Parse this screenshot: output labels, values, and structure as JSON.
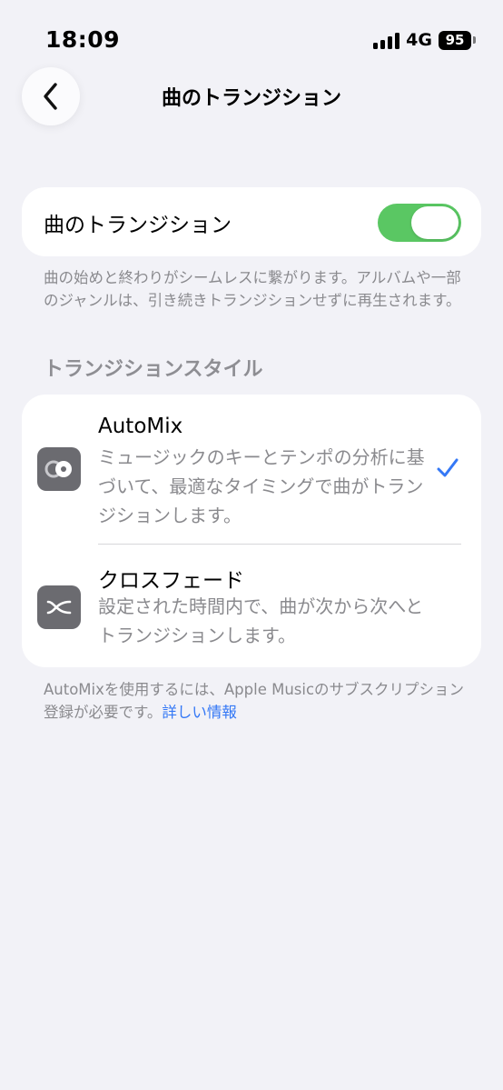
{
  "status_bar": {
    "time": "18:09",
    "network": "4G",
    "battery": "95"
  },
  "nav": {
    "back_icon": "chevron-left-icon",
    "title": "曲のトランジション"
  },
  "transition_toggle": {
    "label": "曲のトランジション",
    "enabled": true,
    "accent": "#5ac763"
  },
  "description": "曲の始めと終わりがシームレスに繋がります。アルバムや一部のジャンルは、引き続きトランジションせずに再生されます。",
  "style_section": {
    "header": "トランジションスタイル",
    "options": [
      {
        "title": "AutoMix",
        "description": "ミュージックのキーとテンポの分析に基づいて、最適なタイミングで曲がトランジションします。",
        "icon": "automix-icon",
        "selected": true
      },
      {
        "title": "クロスフェード",
        "description": "設定された時間内で、曲が次から次へとトランジションします。",
        "icon": "crossfade-icon",
        "selected": false
      }
    ],
    "check_color": "#3478f6"
  },
  "subscription_note": {
    "text": "AutoMixを使用するには、Apple Musicのサブスクリプション登録が必要です。",
    "link": "詳しい情報"
  }
}
